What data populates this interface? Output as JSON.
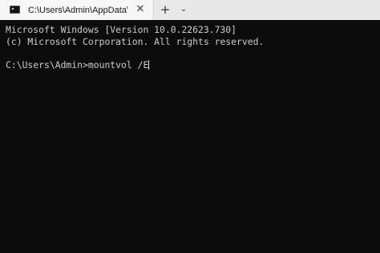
{
  "window": {
    "tab": {
      "icon": "terminal-icon",
      "title": "C:\\Users\\Admin\\AppData\\Roa",
      "close_glyph": "✕"
    },
    "new_tab_glyph": "+",
    "dropdown_glyph": "⌄"
  },
  "console": {
    "lines": [
      "Microsoft Windows [Version 10.0.22623.730]",
      "(c) Microsoft Corporation. All rights reserved."
    ],
    "prompt": "C:\\Users\\Admin>",
    "command": "mountvol /E"
  },
  "colors": {
    "background": "#0c0c0c",
    "text": "#cccccc",
    "titlebar": "#e9e9e9"
  }
}
